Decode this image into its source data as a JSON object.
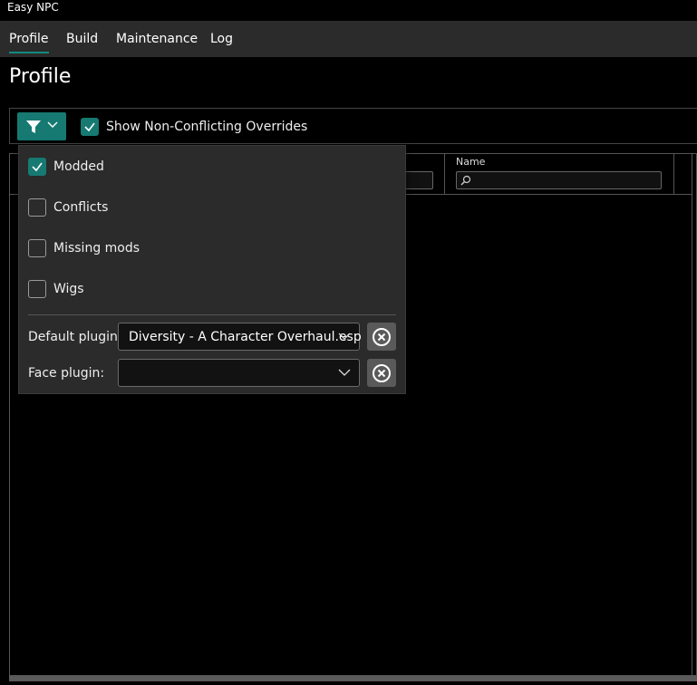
{
  "window": {
    "title": "Easy NPC"
  },
  "nav": {
    "tabs": [
      {
        "label": "Profile",
        "active": true
      },
      {
        "label": "Build"
      },
      {
        "label": "Maintenance"
      },
      {
        "label": "Log"
      }
    ]
  },
  "page": {
    "title": "Profile"
  },
  "toolbar": {
    "filter_icon": "filter-icon",
    "show_non_conflicting": {
      "label": "Show Non-Conflicting Overrides",
      "checked": true
    }
  },
  "filters": {
    "options": [
      {
        "label": "Modded",
        "checked": true
      },
      {
        "label": "Conflicts",
        "checked": false
      },
      {
        "label": "Missing mods",
        "checked": false
      },
      {
        "label": "Wigs",
        "checked": false
      }
    ],
    "default_plugin": {
      "label": "Default plugin:",
      "value": "Diversity - A Character Overhaul.esp"
    },
    "face_plugin": {
      "label": "Face plugin:",
      "value": ""
    }
  },
  "grid": {
    "columns": [
      {
        "header": "Name"
      }
    ]
  },
  "colors": {
    "accent": "#167a72",
    "background": "#000000",
    "panel": "#2b2b2b"
  }
}
